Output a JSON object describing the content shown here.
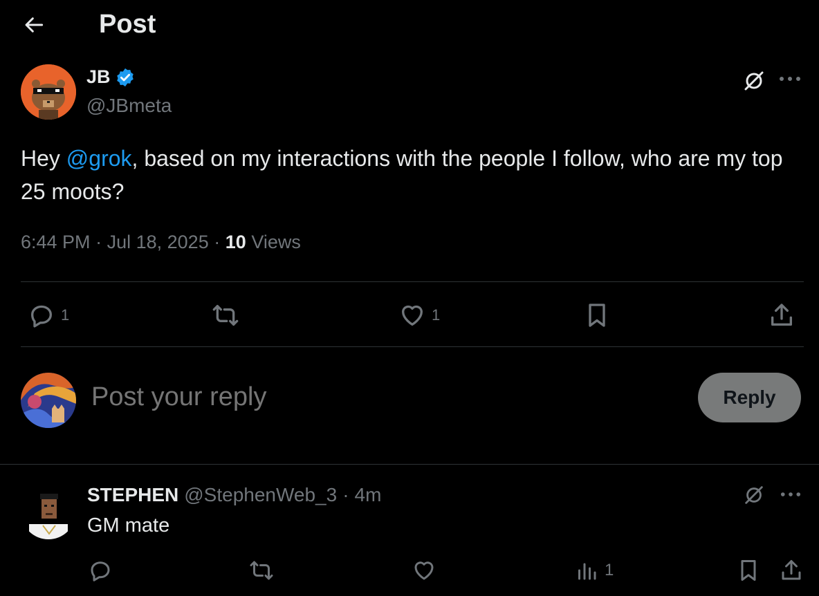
{
  "header": {
    "title": "Post",
    "back_icon": "arrow-left-icon"
  },
  "post": {
    "author": {
      "display_name": "JB",
      "handle": "@JBmeta",
      "verified": true
    },
    "text": {
      "prefix": "Hey ",
      "mention": "@grok",
      "rest": ", based on my interactions with the people I follow, who are my top 25 moots?"
    },
    "time": "6:44 PM",
    "date": "Jul 18, 2025",
    "views_count": "10",
    "views_label": "Views",
    "separator": "·",
    "actions": {
      "reply_count": "1",
      "repost_count": "",
      "like_count": "1"
    }
  },
  "composer": {
    "placeholder": "Post your reply",
    "button_label": "Reply"
  },
  "reply": {
    "display_name": "STEPHEN",
    "handle": "@StephenWeb_3",
    "separator": "·",
    "time": "4m",
    "text": "GM mate",
    "views_count": "1"
  },
  "colors": {
    "background": "#000000",
    "text": "#e7e9ea",
    "muted": "#71767b",
    "accent": "#1d9bf0",
    "avatar_bg": "#e8632b"
  }
}
